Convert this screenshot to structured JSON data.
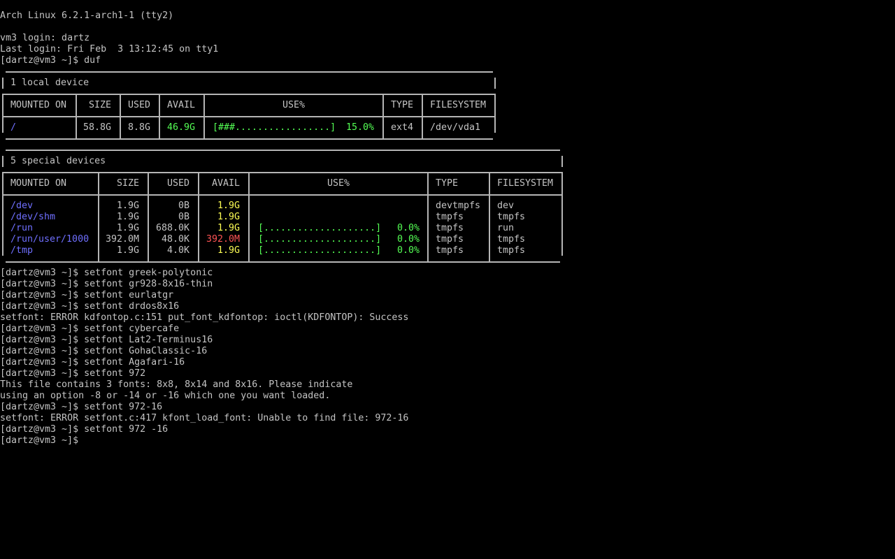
{
  "theme": {
    "background": "#000000",
    "foreground": "#c4c4c4",
    "mount_color": "#6f6fff",
    "green": "#54ff54",
    "yellow": "#ffff54",
    "red": "#ff5454"
  },
  "header": {
    "banner": "Arch Linux 6.2.1-arch1-1 (tty2)",
    "login": "vm3 login: dartz",
    "last_login": "Last login: Fri Feb  3 13:12:45 on tty1",
    "command": "[dartz@vm3 ~]$ duf"
  },
  "local": {
    "title": "1 local device",
    "headers": [
      "MOUNTED ON",
      "SIZE",
      "USED",
      "AVAIL",
      "USE%",
      "TYPE",
      "FILESYSTEM"
    ],
    "rows": [
      {
        "mount": "/",
        "size": "58.8G",
        "used": "8.8G",
        "avail": "46.9G",
        "bar": "[###.................]",
        "pct": "15.0%",
        "type": "ext4",
        "fs": "/dev/vda1"
      }
    ]
  },
  "special": {
    "title": "5 special devices",
    "headers": [
      "MOUNTED ON",
      "SIZE",
      "USED",
      "AVAIL",
      "USE%",
      "TYPE",
      "FILESYSTEM"
    ],
    "rows": [
      {
        "mount": "/dev",
        "size": "1.9G",
        "used": "0B",
        "avail": "1.9G",
        "bar": "",
        "pct": "",
        "type": "devtmpfs",
        "fs": "dev"
      },
      {
        "mount": "/dev/shm",
        "size": "1.9G",
        "used": "0B",
        "avail": "1.9G",
        "bar": "",
        "pct": "",
        "type": "tmpfs",
        "fs": "tmpfs"
      },
      {
        "mount": "/run",
        "size": "1.9G",
        "used": "688.0K",
        "avail": "1.9G",
        "bar": "[....................]",
        "pct": "0.0%",
        "type": "tmpfs",
        "fs": "run"
      },
      {
        "mount": "/run/user/1000",
        "size": "392.0M",
        "used": "48.0K",
        "avail": "392.0M",
        "bar": "[....................]",
        "pct": "0.0%",
        "type": "tmpfs",
        "fs": "tmpfs"
      },
      {
        "mount": "/tmp",
        "size": "1.9G",
        "used": "4.0K",
        "avail": "1.9G",
        "bar": "[....................]",
        "pct": "0.0%",
        "type": "tmpfs",
        "fs": "tmpfs"
      }
    ]
  },
  "history": [
    "[dartz@vm3 ~]$ setfont greek-polytonic",
    "[dartz@vm3 ~]$ setfont gr928-8x16-thin",
    "[dartz@vm3 ~]$ setfont eurlatgr",
    "[dartz@vm3 ~]$ setfont drdos8x16",
    "setfont: ERROR kdfontop.c:151 put_font_kdfontop: ioctl(KDFONTOP): Success",
    "[dartz@vm3 ~]$ setfont cybercafe",
    "[dartz@vm3 ~]$ setfont Lat2-Terminus16",
    "[dartz@vm3 ~]$ setfont GohaClassic-16",
    "[dartz@vm3 ~]$ setfont Agafari-16",
    "[dartz@vm3 ~]$ setfont 972",
    "This file contains 3 fonts: 8x8, 8x14 and 8x16. Please indicate",
    "using an option -8 or -14 or -16 which one you want loaded.",
    "[dartz@vm3 ~]$ setfont 972-16",
    "setfont: ERROR setfont.c:417 kfont_load_font: Unable to find file: 972-16",
    "[dartz@vm3 ~]$ setfont 972 -16",
    "[dartz@vm3 ~]$"
  ]
}
